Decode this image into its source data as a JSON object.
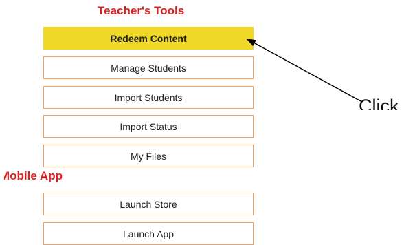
{
  "teacher_tools": {
    "title": "Teacher's Tools",
    "items": [
      {
        "label": "Redeem Content",
        "active": true
      },
      {
        "label": "Manage Students",
        "active": false
      },
      {
        "label": "Import Students",
        "active": false
      },
      {
        "label": "Import Status",
        "active": false
      },
      {
        "label": "My Files",
        "active": false
      }
    ]
  },
  "mobile_app": {
    "title": "Mobile App",
    "items": [
      {
        "label": "Launch Store"
      },
      {
        "label": "Launch App"
      }
    ]
  },
  "annotation": {
    "callout_text": "Click"
  },
  "colors": {
    "heading": "#e02020",
    "active_bg": "#f0d828",
    "button_border": "#f0a060"
  }
}
